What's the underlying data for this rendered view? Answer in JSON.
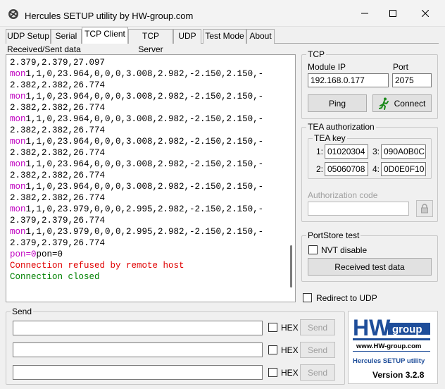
{
  "window": {
    "title": "Hercules SETUP utility by HW-group.com",
    "icon": "hercules-app-icon"
  },
  "tabs": [
    {
      "label": "UDP Setup"
    },
    {
      "label": "Serial"
    },
    {
      "label": "TCP Client",
      "active": true
    },
    {
      "label": "TCP Server"
    },
    {
      "label": "UDP"
    },
    {
      "label": "Test Mode"
    },
    {
      "label": "About"
    }
  ],
  "received": {
    "label": "Received/Sent data",
    "lines": [
      [
        {
          "t": "2.379,2.379,27.097",
          "c": "black"
        }
      ],
      [
        {
          "t": "mon",
          "c": "purple"
        },
        {
          "t": "1,1,0,23.964,0,0,0,3.008,2.982,-2.150,2.150,-",
          "c": "black"
        }
      ],
      [
        {
          "t": "2.382,2.382,26.774",
          "c": "black"
        }
      ],
      [
        {
          "t": "mon",
          "c": "purple"
        },
        {
          "t": "1,1,0,23.964,0,0,0,3.008,2.982,-2.150,2.150,-",
          "c": "black"
        }
      ],
      [
        {
          "t": "2.382,2.382,26.774",
          "c": "black"
        }
      ],
      [
        {
          "t": "mon",
          "c": "purple"
        },
        {
          "t": "1,1,0,23.964,0,0,0,3.008,2.982,-2.150,2.150,-",
          "c": "black"
        }
      ],
      [
        {
          "t": "2.382,2.382,26.774",
          "c": "black"
        }
      ],
      [
        {
          "t": "mon",
          "c": "purple"
        },
        {
          "t": "1,1,0,23.964,0,0,0,3.008,2.982,-2.150,2.150,-",
          "c": "black"
        }
      ],
      [
        {
          "t": "2.382,2.382,26.774",
          "c": "black"
        }
      ],
      [
        {
          "t": "mon",
          "c": "purple"
        },
        {
          "t": "1,1,0,23.964,0,0,0,3.008,2.982,-2.150,2.150,-",
          "c": "black"
        }
      ],
      [
        {
          "t": "2.382,2.382,26.774",
          "c": "black"
        }
      ],
      [
        {
          "t": "mon",
          "c": "purple"
        },
        {
          "t": "1,1,0,23.964,0,0,0,3.008,2.982,-2.150,2.150,-",
          "c": "black"
        }
      ],
      [
        {
          "t": "2.382,2.382,26.774",
          "c": "black"
        }
      ],
      [
        {
          "t": "mon",
          "c": "purple"
        },
        {
          "t": "1,1,0,23.979,0,0,0,2.995,2.982,-2.150,2.150,-",
          "c": "black"
        }
      ],
      [
        {
          "t": "2.379,2.379,26.774",
          "c": "black"
        }
      ],
      [
        {
          "t": "mon",
          "c": "purple"
        },
        {
          "t": "1,1,0,23.979,0,0,0,2.995,2.982,-2.150,2.150,-",
          "c": "black"
        }
      ],
      [
        {
          "t": "2.379,2.379,26.774",
          "c": "black"
        }
      ],
      [
        {
          "t": "pon=0",
          "c": "purple"
        },
        {
          "t": "pon=0",
          "c": "black"
        }
      ],
      [
        {
          "t": "Connection refused by remote host",
          "c": "red"
        }
      ],
      [
        {
          "t": "Connection closed",
          "c": "green"
        }
      ]
    ]
  },
  "tcp": {
    "legend": "TCP",
    "module_ip_label": "Module IP",
    "module_ip": "192.168.0.177",
    "port_label": "Port",
    "port": "2075",
    "ping_label": "Ping",
    "connect_label": "Connect"
  },
  "tea": {
    "legend": "TEA authorization",
    "key_legend": "TEA key",
    "keys": [
      {
        "num": "1:",
        "value": "01020304"
      },
      {
        "num": "2:",
        "value": "05060708"
      },
      {
        "num": "3:",
        "value": "090A0B0C"
      },
      {
        "num": "4:",
        "value": "0D0E0F10"
      }
    ],
    "auth_code_label": "Authorization code",
    "auth_code": ""
  },
  "portstore": {
    "legend": "PortStore test",
    "nvt_label": "NVT disable",
    "received_test_label": "Received test data"
  },
  "redirect_label": "Redirect to UDP",
  "send": {
    "legend": "Send",
    "rows": [
      {
        "value": "",
        "hex_label": "HEX",
        "send_label": "Send"
      },
      {
        "value": "",
        "hex_label": "HEX",
        "send_label": "Send"
      },
      {
        "value": "",
        "hex_label": "HEX",
        "send_label": "Send"
      }
    ]
  },
  "logo": {
    "brand": "HW",
    "brand_sub": "group",
    "url": "www.HW-group.com",
    "product": "Hercules SETUP utility",
    "version": "Version  3.2.8"
  },
  "colors": {
    "black": "#000000",
    "purple": "#c000c0",
    "red": "#e00000",
    "green": "#008000",
    "logo_blue": "#1f4e9a"
  }
}
